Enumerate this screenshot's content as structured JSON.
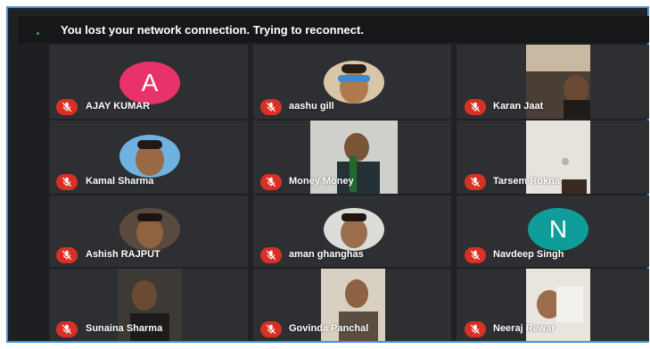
{
  "banner": {
    "message": "You lost your network connection. Trying to reconnect."
  },
  "participants": [
    {
      "name": "AJAY KUMAR",
      "avatar_letter": "A",
      "avatar_color": "#e8336a",
      "muted": true
    },
    {
      "name": "aashu gill",
      "muted": true
    },
    {
      "name": "Karan Jaat",
      "muted": true
    },
    {
      "name": "Kamal Sharma",
      "muted": true
    },
    {
      "name": "Money Money",
      "muted": true
    },
    {
      "name": "Tarsem Rokna",
      "muted": true
    },
    {
      "name": "Ashish RAJPUT",
      "muted": true
    },
    {
      "name": "aman ghanghas",
      "muted": true
    },
    {
      "name": "Navdeep Singh",
      "avatar_letter": "N",
      "avatar_color": "#0f9d9a",
      "muted": true
    },
    {
      "name": "Sunaina Sharma",
      "muted": true
    },
    {
      "name": "Govinda Panchal",
      "muted": true
    },
    {
      "name": "Neeraj Rewar",
      "muted": true
    }
  ],
  "colors": {
    "muted_mic": "#d93025",
    "banner_bg": "#161719",
    "tile_bg": "#2e2f32",
    "frame_border": "#4a8fd8"
  },
  "icons": {
    "muted_mic": "mic-off-icon"
  }
}
